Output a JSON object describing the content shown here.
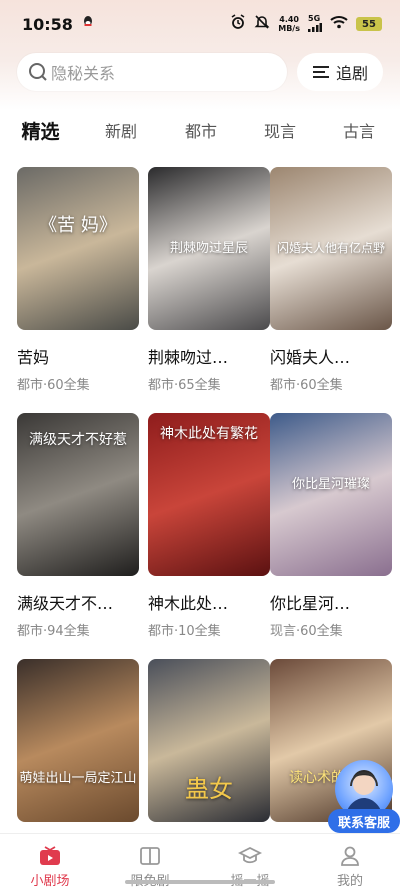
{
  "status_bar": {
    "time": "10:58",
    "net_speed": "4.40",
    "net_unit": "MB/s",
    "network": "5G",
    "battery": "55"
  },
  "search": {
    "placeholder": "隐秘关系",
    "follow_label": "追剧"
  },
  "tabs": [
    {
      "label": "精选",
      "active": true
    },
    {
      "label": "新剧",
      "active": false
    },
    {
      "label": "都市",
      "active": false
    },
    {
      "label": "现言",
      "active": false
    },
    {
      "label": "古言",
      "active": false
    }
  ],
  "cards": [
    {
      "title": "苦妈",
      "meta": "都市·60全集",
      "poster_text": "《苦 妈》",
      "colors": [
        "#6b6a66",
        "#c9b79a",
        "#4a4b47"
      ]
    },
    {
      "title": "荆棘吻过…",
      "meta": "都市·65全集",
      "poster_text": "荆棘吻过星辰",
      "colors": [
        "#2b2b2d",
        "#d9d4cf",
        "#4b4a4c"
      ]
    },
    {
      "title": "闪婚夫人…",
      "meta": "都市·60全集",
      "poster_text": "闪婚夫人他有亿点野",
      "colors": [
        "#9c8670",
        "#e6ddd3",
        "#6a5648"
      ]
    },
    {
      "title": "满级天才不…",
      "meta": "都市·94全集",
      "poster_text": "满级天才不好惹",
      "colors": [
        "#3a3836",
        "#8f8a82",
        "#1f1e1d"
      ]
    },
    {
      "title": "神木此处…",
      "meta": "都市·10全集",
      "poster_text": "神木此处有繁花",
      "colors": [
        "#8e1c1c",
        "#c9453a",
        "#5b1111"
      ]
    },
    {
      "title": "你比星河…",
      "meta": "现言·60全集",
      "poster_text": "你比星河璀璨",
      "colors": [
        "#3e5b8a",
        "#d7c9cf",
        "#8a6f8f"
      ]
    },
    {
      "title": "",
      "meta": "",
      "poster_text": "萌娃出山一局定江山",
      "colors": [
        "#3a2f2a",
        "#b88a5e",
        "#6b4a2e"
      ]
    },
    {
      "title": "",
      "meta": "",
      "poster_text": "蛊女",
      "colors": [
        "#4a4f5a",
        "#c9b89a",
        "#2a2c33"
      ]
    },
    {
      "title": "",
      "meta": "",
      "poster_text": "读心术的替嫁",
      "colors": [
        "#6b4a3a",
        "#e2c9a8",
        "#4a3326"
      ]
    }
  ],
  "service_badge": {
    "label": "联系客服"
  },
  "bottom_nav": [
    {
      "label": "小剧场",
      "icon": "tv-icon",
      "active": true
    },
    {
      "label": "限免剧",
      "icon": "book-icon",
      "active": false
    },
    {
      "label": "摇一摇",
      "icon": "graduation-cap-icon",
      "active": false
    },
    {
      "label": "我的",
      "icon": "person-icon",
      "active": false
    }
  ],
  "colors": {
    "accent": "#e03b4e",
    "service_blue": "#2f6fe8"
  }
}
